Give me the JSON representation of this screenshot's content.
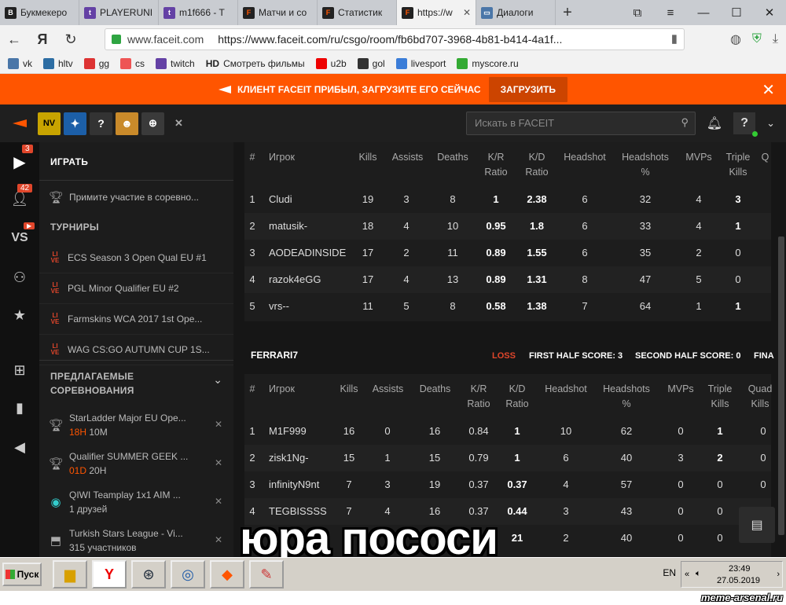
{
  "browser": {
    "tabs": [
      {
        "label": "Букмекеро",
        "color": "#222",
        "glyph": "B"
      },
      {
        "label": "PLAYERUNI",
        "color": "#6441a5",
        "glyph": "t"
      },
      {
        "label": "m1f666 - T",
        "color": "#6441a5",
        "glyph": "t"
      },
      {
        "label": "Матчи и со",
        "color": "#222",
        "glyph": "F"
      },
      {
        "label": "Статистик",
        "color": "#222",
        "glyph": "F"
      },
      {
        "label": "https://w",
        "color": "#222",
        "glyph": "F"
      },
      {
        "label": "Диалоги",
        "color": "#4a76a8",
        "glyph": "▭"
      }
    ],
    "domain": "www.faceit.com",
    "url": "https://www.faceit.com/ru/csgo/room/fb6bd707-3968-4b81-b414-4a1f...",
    "bookmarks": [
      {
        "label": "vk",
        "color": "#4a76a8"
      },
      {
        "label": "hltv",
        "color": "#2d6da3"
      },
      {
        "label": "gg",
        "color": "#d33"
      },
      {
        "label": "cs",
        "color": "#e55"
      },
      {
        "label": "twitch",
        "color": "#6441a5"
      },
      {
        "label": "Смотреть фильмы",
        "color": "#fff"
      },
      {
        "label": "u2b",
        "color": "#e00"
      },
      {
        "label": "gol",
        "color": "#333"
      },
      {
        "label": "livesport",
        "color": "#3b7dd8"
      },
      {
        "label": "myscore.ru",
        "color": "#3a3"
      }
    ],
    "hd_label": "HD",
    "ya_label": "Я"
  },
  "banner": {
    "text": "КЛИЕНТ FACEIT ПРИБЫЛ, ЗАГРУЗИТЕ ЕГО СЕЙЧАС",
    "button": "ЗАГРУЗИТЬ"
  },
  "topbar": {
    "search_placeholder": "Искать в FACEIT",
    "party_q": "?",
    "help": "?"
  },
  "rail": {
    "badges": [
      "3",
      "42"
    ],
    "vs": "VS"
  },
  "side": {
    "play": "ИГРАТЬ",
    "join": "Примите участие в соревно...",
    "tournaments_header": "ТУРНИРЫ",
    "tournaments": [
      "ECS Season 3 Open Qual EU #1",
      "PGL Minor Qualifier EU #2",
      "Farmskins WCA 2017 1st Ope...",
      "WAG CS:GO AUTUMN CUP 1S..."
    ],
    "live_label": "LI VE",
    "suggested_header_1": "ПРЕДЛАГАЕМЫЕ",
    "suggested_header_2": "СОРЕВНОВАНИЯ",
    "suggested": [
      {
        "name": "StarLadder Major EU Ope...",
        "hl": "18H",
        "rest": " 10M"
      },
      {
        "name": "Qualifier SUMMER GEEK ...",
        "hl": "01D",
        "rest": " 20H"
      },
      {
        "name": "QIWI Teamplay 1x1 AIM ...",
        "hl": "",
        "rest": "1 друзей"
      },
      {
        "name": "Turkish Stars League - Vi...",
        "hl": "",
        "rest": "315 участников"
      }
    ]
  },
  "headers": {
    "num": "#",
    "player": "Игрок",
    "kills": "Kills",
    "assists": "Assists",
    "deaths": "Deaths",
    "kr1": "K/R",
    "kr2": "Ratio",
    "kd1": "K/D",
    "kd2": "Ratio",
    "hs": "Headshot",
    "hsp1": "Headshots",
    "hsp2": "%",
    "mvps": "MVPs",
    "tk1": "Triple",
    "tk2": "Kills",
    "qk1": "Quad",
    "qk2": "Kills",
    "q_trunc": "Q"
  },
  "team1": {
    "rows": [
      [
        "1",
        "Cludi",
        "19",
        "3",
        "8",
        "1",
        "2.38",
        "6",
        "32",
        "4",
        "3"
      ],
      [
        "2",
        "matusik-",
        "18",
        "4",
        "10",
        "0.95",
        "1.8",
        "6",
        "33",
        "4",
        "1"
      ],
      [
        "3",
        "AODEADINSIDE",
        "17",
        "2",
        "11",
        "0.89",
        "1.55",
        "6",
        "35",
        "2",
        "0"
      ],
      [
        "4",
        "razok4eGG",
        "17",
        "4",
        "13",
        "0.89",
        "1.31",
        "8",
        "47",
        "5",
        "0"
      ],
      [
        "5",
        "vrs--",
        "11",
        "5",
        "8",
        "0.58",
        "1.38",
        "7",
        "64",
        "1",
        "1"
      ]
    ]
  },
  "team2": {
    "name": "FERRARI7",
    "result": "LOSS",
    "first_half": "FIRST HALF SCORE: 3",
    "second_half": "SECOND HALF SCORE: 0",
    "final_trunc": "FINA",
    "rows": [
      [
        "1",
        "M1F999",
        "16",
        "0",
        "16",
        "0.84",
        "1",
        "10",
        "62",
        "0",
        "1",
        "0"
      ],
      [
        "2",
        "zisk1Ng-",
        "15",
        "1",
        "15",
        "0.79",
        "1",
        "6",
        "40",
        "3",
        "2",
        "0"
      ],
      [
        "3",
        "infinityN9nt",
        "7",
        "3",
        "19",
        "0.37",
        "0.37",
        "4",
        "57",
        "0",
        "0",
        "0"
      ],
      [
        "4",
        "TEGBISSSS",
        "7",
        "4",
        "16",
        "0.37",
        "0.44",
        "3",
        "43",
        "0",
        "0",
        "0"
      ],
      [
        "5",
        "",
        "5",
        "",
        "",
        "",
        "21",
        "2",
        "40",
        "0",
        "0",
        "0"
      ]
    ]
  },
  "caption": "юра пососи",
  "taskbar": {
    "start": "Пуск",
    "lang": "EN",
    "time": "23:49",
    "date": "27.05.2019"
  },
  "watermark": "meme-arsenal.ru"
}
